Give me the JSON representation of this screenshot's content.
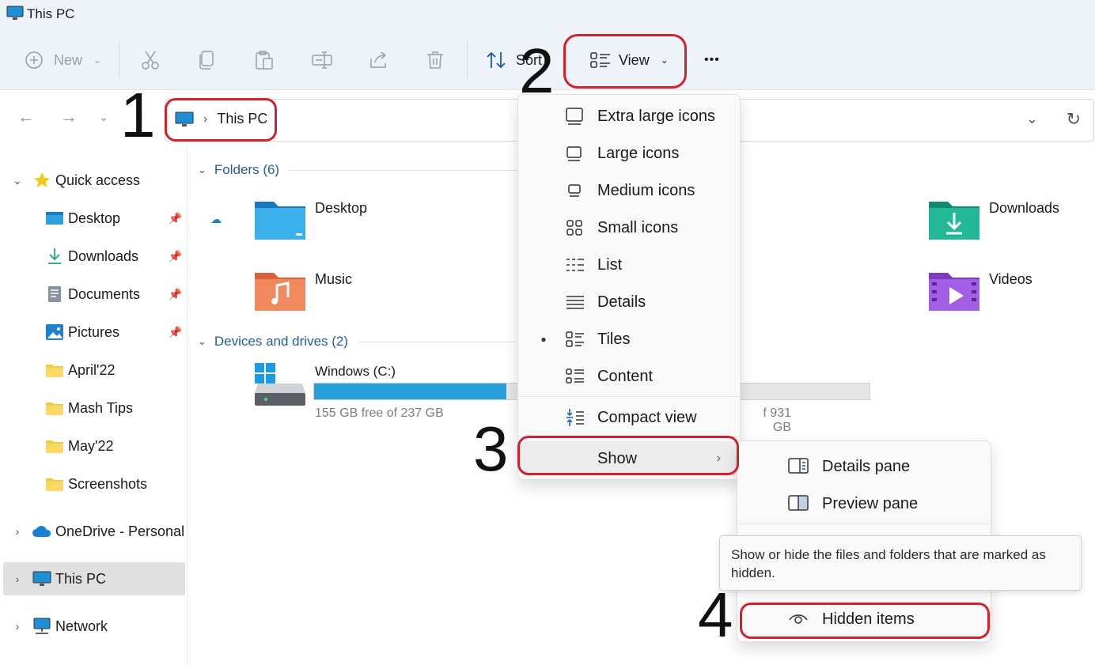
{
  "window": {
    "title": "This PC"
  },
  "toolbar": {
    "new_label": "New",
    "sort_label": "Sort",
    "view_label": "View",
    "more_label": "•••"
  },
  "address": {
    "breadcrumb": "This PC"
  },
  "sidebar": {
    "items": [
      {
        "label": "Quick access"
      },
      {
        "label": "Desktop"
      },
      {
        "label": "Downloads"
      },
      {
        "label": "Documents"
      },
      {
        "label": "Pictures"
      },
      {
        "label": "April'22"
      },
      {
        "label": "Mash Tips"
      },
      {
        "label": "May'22"
      },
      {
        "label": "Screenshots"
      },
      {
        "label": "OneDrive - Personal"
      },
      {
        "label": "This PC"
      },
      {
        "label": "Network"
      }
    ]
  },
  "content": {
    "folders_header": "Folders (6)",
    "folders": [
      {
        "label": "Desktop"
      },
      {
        "label": "Downloads"
      },
      {
        "label": "Music"
      },
      {
        "label": "Videos"
      }
    ],
    "drives_header": "Devices and drives (2)",
    "drives": [
      {
        "label": "Windows (C:)",
        "free_text": "155 GB free of 237 GB",
        "used_fraction": 0.346
      },
      {
        "free_text_partial": "f 931 GB",
        "used_fraction": 0.0
      }
    ]
  },
  "view_menu": {
    "items": [
      {
        "label": "Extra large icons"
      },
      {
        "label": "Large icons"
      },
      {
        "label": "Medium icons"
      },
      {
        "label": "Small icons"
      },
      {
        "label": "List"
      },
      {
        "label": "Details"
      },
      {
        "label": "Tiles",
        "selected": true
      },
      {
        "label": "Content"
      },
      {
        "label": "Compact view"
      },
      {
        "label": "Show"
      }
    ]
  },
  "show_menu": {
    "items": [
      {
        "label": "Details pane"
      },
      {
        "label": "Preview pane"
      },
      {
        "label": "Hidden items"
      }
    ]
  },
  "tooltip": {
    "text": "Show or hide the files and folders that are marked as hidden."
  },
  "annotations": {
    "step1": "1",
    "step2": "2",
    "step3": "3",
    "step4": "4"
  },
  "colors": {
    "annotation": "#d4202b",
    "accent": "#26a0da",
    "chrome": "#eef2f9"
  }
}
